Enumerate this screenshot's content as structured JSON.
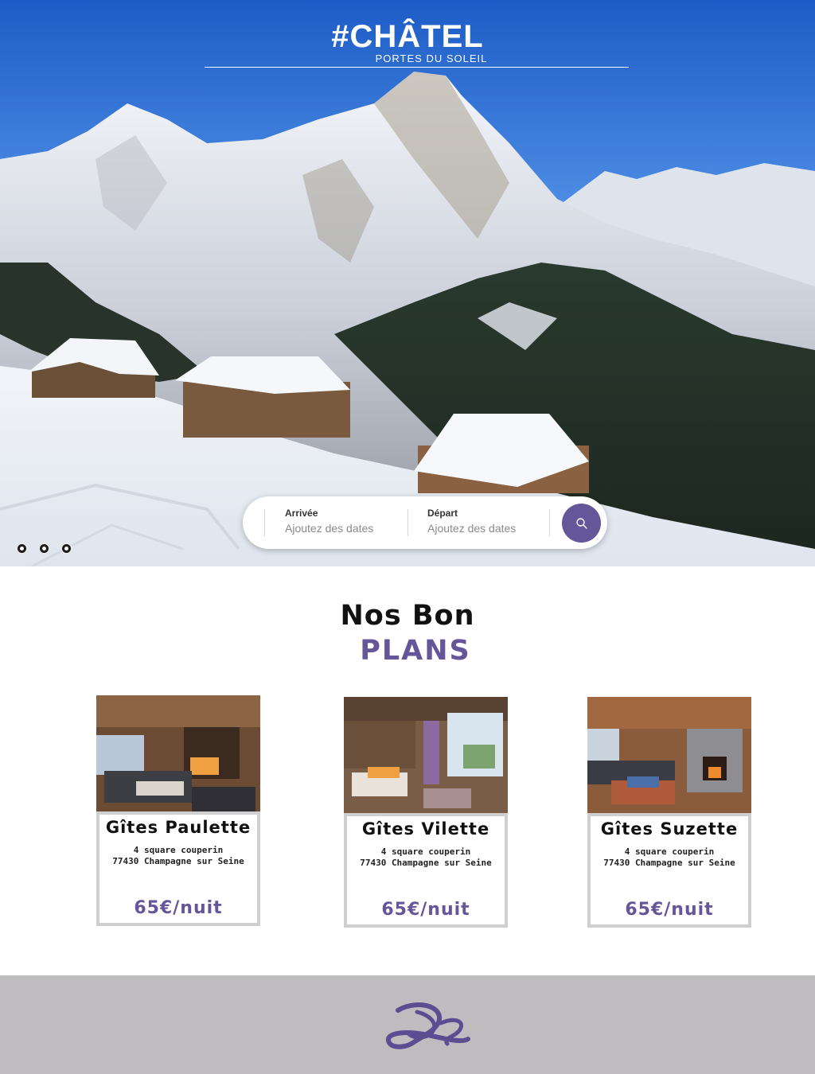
{
  "brand": {
    "logo_main": "#CHÂTEL",
    "logo_sub": "PORTES DU SOLEIL",
    "accent": "#65569a"
  },
  "search": {
    "arrival_label": "Arrivée",
    "arrival_placeholder": "Ajoutez des dates",
    "departure_label": "Départ",
    "departure_placeholder": "Ajoutez des dates",
    "button_icon": "search-icon"
  },
  "carousel": {
    "dots": 3
  },
  "plans": {
    "title_line1": "Nos Bon",
    "title_line2": "PLANS",
    "cards": [
      {
        "name": "Gîtes Paulette",
        "address_line1": "4 square couperin",
        "address_line2": "77430 Champagne sur Seine",
        "price": "65€/nuit"
      },
      {
        "name": "Gîtes Vilette",
        "address_line1": "4 square couperin",
        "address_line2": "77430 Champagne sur Seine",
        "price": "65€/nuit"
      },
      {
        "name": "Gîtes Suzette",
        "address_line1": "4 square couperin",
        "address_line2": "77430 Champagne sur Seine",
        "price": "65€/nuit"
      }
    ]
  },
  "footer": {
    "monogram_icon": "ys-monogram-logo"
  }
}
